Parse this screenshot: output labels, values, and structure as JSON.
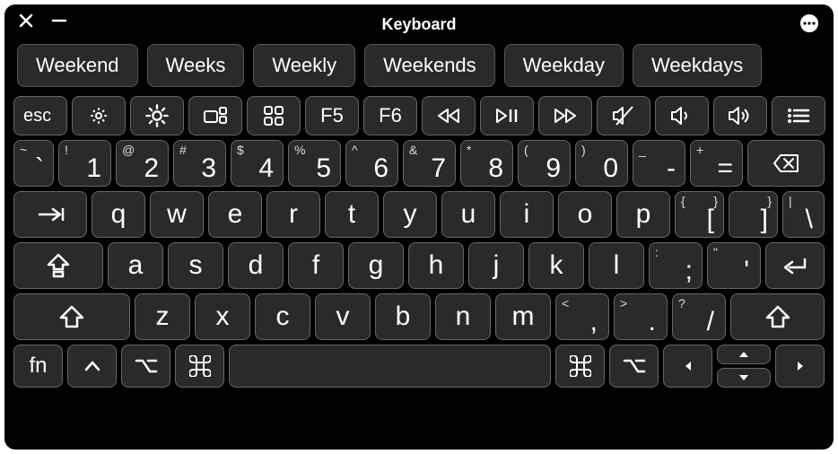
{
  "title": "Keyboard",
  "suggestions": [
    "Weekend",
    "Weeks",
    "Weekly",
    "Weekends",
    "Weekday",
    "Weekdays"
  ],
  "fn_row": {
    "esc": "esc",
    "f5": "F5",
    "f6": "F6"
  },
  "number_row": [
    {
      "shift": "~",
      "main": "`"
    },
    {
      "shift": "!",
      "main": "1"
    },
    {
      "shift": "@",
      "main": "2"
    },
    {
      "shift": "#",
      "main": "3"
    },
    {
      "shift": "$",
      "main": "4"
    },
    {
      "shift": "%",
      "main": "5"
    },
    {
      "shift": "^",
      "main": "6"
    },
    {
      "shift": "&",
      "main": "7"
    },
    {
      "shift": "*",
      "main": "8"
    },
    {
      "shift": "(",
      "main": "9"
    },
    {
      "shift": ")",
      "main": "0"
    },
    {
      "shift": "_",
      "main": "-"
    },
    {
      "shift": "+",
      "main": "="
    }
  ],
  "qwerty_row": {
    "letters": [
      "q",
      "w",
      "e",
      "r",
      "t",
      "y",
      "u",
      "i",
      "o",
      "p"
    ],
    "brackets": [
      {
        "shift": "{",
        "main": "["
      },
      {
        "shift": "}",
        "main": "]"
      },
      {
        "shift": "|",
        "main": "\\"
      }
    ]
  },
  "asdf_row": {
    "letters": [
      "a",
      "s",
      "d",
      "f",
      "g",
      "h",
      "j",
      "k",
      "l"
    ],
    "punct": [
      {
        "shift": ":",
        "main": ";"
      },
      {
        "shift": "\"",
        "main": "'"
      }
    ]
  },
  "zxcv_row": {
    "letters": [
      "z",
      "x",
      "c",
      "v",
      "b",
      "n",
      "m"
    ],
    "punct": [
      {
        "shift": "<",
        "main": ","
      },
      {
        "shift": ">",
        "main": "."
      },
      {
        "shift": "?",
        "main": "/"
      }
    ]
  },
  "bottom_row": {
    "fn": "fn"
  }
}
